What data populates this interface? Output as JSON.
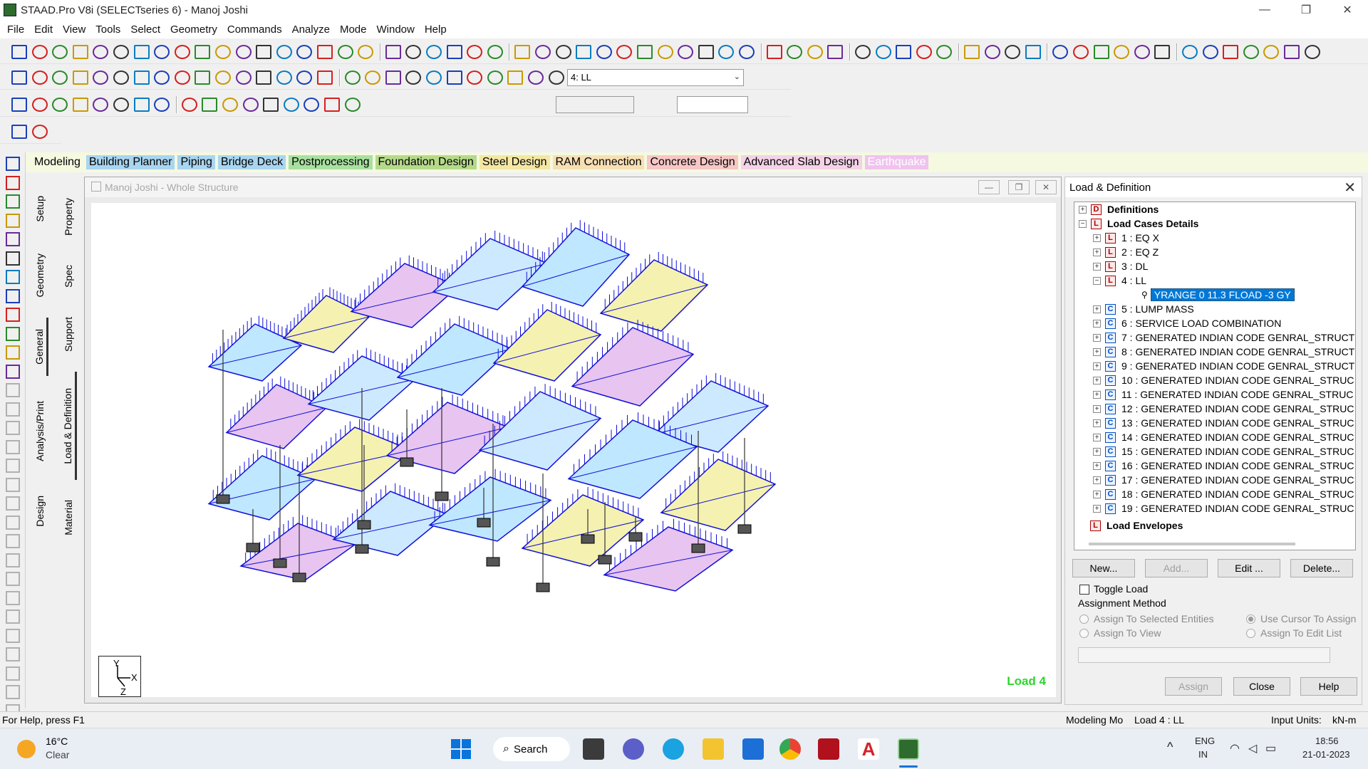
{
  "window": {
    "title": "STAAD.Pro V8i (SELECTseries 6) - Manoj Joshi",
    "controls": {
      "minimize": "—",
      "maximize": "❐",
      "close": "✕"
    }
  },
  "menu": [
    "File",
    "Edit",
    "View",
    "Tools",
    "Select",
    "Geometry",
    "Commands",
    "Analyze",
    "Mode",
    "Window",
    "Help"
  ],
  "toolbar": {
    "load_combo": "4: LL",
    "combo_arrow": "⌄"
  },
  "mode_tabs": [
    {
      "label": "Modeling",
      "color": "#f5f9e0"
    },
    {
      "label": "Building Planner",
      "color": "#a9d5f0"
    },
    {
      "label": "Piping",
      "color": "#a9d5f0"
    },
    {
      "label": "Bridge Deck",
      "color": "#a9d5f0"
    },
    {
      "label": "Postprocessing",
      "color": "#a8e0a0"
    },
    {
      "label": "Foundation Design",
      "color": "#b5d98a"
    },
    {
      "label": "Steel Design",
      "color": "#f3e7a4"
    },
    {
      "label": "RAM Connection",
      "color": "#f7dfb4"
    },
    {
      "label": "Concrete Design",
      "color": "#f7c6c6"
    },
    {
      "label": "Advanced Slab Design",
      "color": "#f4d2e8"
    },
    {
      "label": "Earthquake",
      "color": "#f0c3ef"
    }
  ],
  "vertical_tabs_outer": [
    "Setup",
    "Geometry",
    "General",
    "Analysis/Print",
    "Design"
  ],
  "vertical_tabs_inner": [
    "Property",
    "Spec",
    "Support",
    "Load & Definition",
    "Material"
  ],
  "viewport": {
    "title": "Manoj Joshi - Whole Structure",
    "load_label": "Load 4",
    "axis_labels": {
      "y": "Y",
      "x": "X",
      "z": "Z"
    }
  },
  "panel": {
    "title": "Load & Definition",
    "tree": {
      "definitions": "Definitions",
      "load_cases_details": "Load Cases Details",
      "items": [
        {
          "badge": "L",
          "label": "1 : EQ X"
        },
        {
          "badge": "L",
          "label": "2 : EQ Z"
        },
        {
          "badge": "L",
          "label": "3 : DL"
        },
        {
          "badge": "L",
          "label": "4 : LL"
        },
        {
          "badge": "C",
          "label": "5 : LUMP MASS"
        },
        {
          "badge": "C",
          "label": "6 : SERVICE LOAD COMBINATION"
        },
        {
          "badge": "C",
          "label": "7 : GENERATED INDIAN CODE GENRAL_STRUCT"
        },
        {
          "badge": "C",
          "label": "8 : GENERATED INDIAN CODE GENRAL_STRUCT"
        },
        {
          "badge": "C",
          "label": "9 : GENERATED INDIAN CODE GENRAL_STRUCT"
        },
        {
          "badge": "C",
          "label": "10 : GENERATED INDIAN CODE GENRAL_STRUC"
        },
        {
          "badge": "C",
          "label": "11 : GENERATED INDIAN CODE GENRAL_STRUC"
        },
        {
          "badge": "C",
          "label": "12 : GENERATED INDIAN CODE GENRAL_STRUC"
        },
        {
          "badge": "C",
          "label": "13 : GENERATED INDIAN CODE GENRAL_STRUC"
        },
        {
          "badge": "C",
          "label": "14 : GENERATED INDIAN CODE GENRAL_STRUC"
        },
        {
          "badge": "C",
          "label": "15 : GENERATED INDIAN CODE GENRAL_STRUC"
        },
        {
          "badge": "C",
          "label": "16 : GENERATED INDIAN CODE GENRAL_STRUC"
        },
        {
          "badge": "C",
          "label": "17 : GENERATED INDIAN CODE GENRAL_STRUC"
        },
        {
          "badge": "C",
          "label": "18 : GENERATED INDIAN CODE GENRAL_STRUC"
        },
        {
          "badge": "C",
          "label": "19 : GENERATED INDIAN CODE GENRAL_STRUC"
        }
      ],
      "selected_child": "YRANGE 0 11.3 FLOAD -3 GY",
      "load_envelopes": "Load Envelopes"
    },
    "buttons": {
      "new": "New...",
      "add": "Add...",
      "edit": "Edit ...",
      "delete": "Delete...",
      "assign": "Assign",
      "close": "Close",
      "help": "Help"
    },
    "toggle_load": "Toggle Load",
    "assignment_method": "Assignment Method",
    "radios": {
      "selected_entities": "Assign To Selected Entities",
      "view": "Assign To View",
      "cursor": "Use Cursor To Assign",
      "edit_list": "Assign To Edit List"
    }
  },
  "statusbar": {
    "help": "For Help, press F1",
    "mode": "Modeling Mo",
    "load": "Load 4 : LL",
    "units_label": "Input Units:",
    "units": "kN-m"
  },
  "taskbar": {
    "weather_temp": "16°C",
    "weather_desc": "Clear",
    "search": "Search",
    "lang1": "ENG",
    "lang2": "IN",
    "time": "18:56",
    "date": "21-01-2023",
    "chevron": "^"
  }
}
